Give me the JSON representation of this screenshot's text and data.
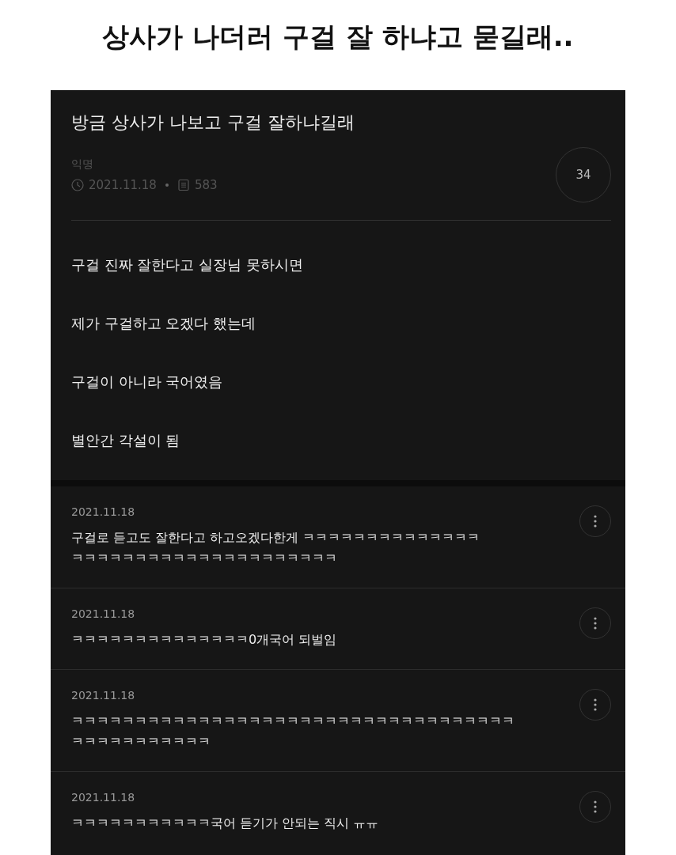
{
  "headline": "상사가 나더러 구걸 잘 하냐고 묻길래..",
  "post": {
    "title": "방금 상사가 나보고 구걸 잘하냐길래",
    "author": "익명",
    "date": "2021.11.18",
    "views": "583",
    "comment_count": "34",
    "paragraphs": [
      "구걸 진짜 잘한다고 실장님 못하시면",
      "제가 구걸하고 오겠다  했는데",
      "구걸이 아니라 국어였음",
      "별안간 각설이 됨"
    ]
  },
  "comments": [
    {
      "date": "2021.11.18",
      "lines": [
        "구걸로 듣고도 잘한다고 하고오겠다한게  ㅋㅋㅋㅋㅋㅋㅋㅋㅋㅋㅋㅋㅋㅋ",
        "ㅋㅋㅋㅋㅋㅋㅋㅋㅋㅋㅋㅋㅋㅋㅋㅋㅋㅋㅋㅋㅋ"
      ]
    },
    {
      "date": "2021.11.18",
      "lines": [
        "ㅋㅋㅋㅋㅋㅋㅋㅋㅋㅋㅋㅋㅋㅋ0개국어 되벌임"
      ]
    },
    {
      "date": "2021.11.18",
      "lines": [
        "ㅋㅋㅋㅋㅋㅋㅋㅋㅋㅋㅋㅋㅋㅋㅋㅋㅋㅋㅋㅋㅋㅋㅋㅋㅋㅋㅋㅋㅋㅋㅋㅋㅋㅋㅋ",
        "ㅋㅋㅋㅋㅋㅋㅋㅋㅋㅋㅋ"
      ]
    },
    {
      "date": "2021.11.18",
      "lines": [
        "ㅋㅋㅋㅋㅋㅋㅋㅋㅋㅋㅋ국어 듣기가 안되는 직시 ㅠㅠ"
      ]
    }
  ]
}
